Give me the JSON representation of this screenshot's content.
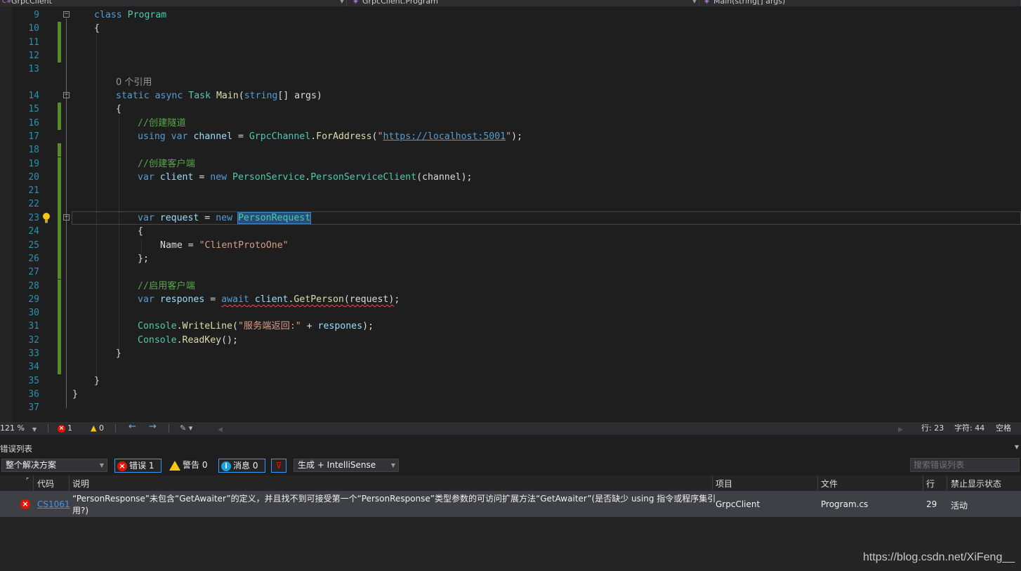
{
  "nav": {
    "project": "GrpcClient",
    "class": "GrpcClient.Program",
    "member": "Main(string[] args)"
  },
  "editor": {
    "codelens": "0 个引用",
    "lines": [
      {
        "n": "9"
      },
      {
        "n": "10"
      },
      {
        "n": "11"
      },
      {
        "n": "12"
      },
      {
        "n": "13"
      },
      {
        "n": "14"
      },
      {
        "n": "15"
      },
      {
        "n": "16"
      },
      {
        "n": "17"
      },
      {
        "n": "18"
      },
      {
        "n": "19"
      },
      {
        "n": "20"
      },
      {
        "n": "21"
      },
      {
        "n": "22"
      },
      {
        "n": "23"
      },
      {
        "n": "24"
      },
      {
        "n": "25"
      },
      {
        "n": "26"
      },
      {
        "n": "27"
      },
      {
        "n": "28"
      },
      {
        "n": "29"
      },
      {
        "n": "30"
      },
      {
        "n": "31"
      },
      {
        "n": "32"
      },
      {
        "n": "33"
      },
      {
        "n": "34"
      },
      {
        "n": "35"
      },
      {
        "n": "36"
      },
      {
        "n": "37"
      }
    ],
    "tokens": {
      "class_kw": "class",
      "program": "Program",
      "open_brace": "{",
      "close_brace": "}",
      "static": "static",
      "async": "async",
      "task": "Task",
      "main": "Main",
      "string": "string",
      "args_sig": "[] args)",
      "main_open": "(",
      "c1": "//创建隧道",
      "using": "using",
      "var": "var",
      "channel": "channel",
      "eq": " = ",
      "grpcchannel": "GrpcChannel",
      "foraddress": "ForAddress",
      "url_q1": "\"",
      "url": "https://localhost:5001",
      "url_tail": "\");",
      "c2": "//创建客户端",
      "client": "client",
      "new": "new",
      "personservice": "PersonService",
      "personserviceclient": "PersonServiceClient",
      "channel_arg": "(channel);",
      "request": "request",
      "personrequest": "PersonRequest",
      "name_prop": "Name",
      "name_val": "\"ClientProtoOne\"",
      "end_init": "};",
      "c3": "//启用客户端",
      "respones": "respones",
      "await": "await",
      "getperson": "GetPerson",
      "req_arg": "(request)",
      "semi": ";",
      "console": "Console",
      "writeline": "WriteLine",
      "write_str": "\"服务端返回:\"",
      "plus": " + ",
      "wl_tail": ");",
      "readkey": "ReadKey",
      "rk_tail": "();",
      "dot": ".",
      "lp": "(",
      "rp": ")",
      "comma": ","
    }
  },
  "status": {
    "zoom": "121 %",
    "errors": "1",
    "warnings": "0",
    "line": "行: 23",
    "char": "字符: 44",
    "mode": "空格"
  },
  "error_list": {
    "title": "错误列表",
    "scope": "整个解决方案",
    "errors_btn": "错误 1",
    "warnings_btn": "警告 0",
    "messages_btn": "消息 0",
    "build_filter": "生成 + IntelliSense",
    "search_placeholder": "搜索错误列表",
    "columns": {
      "code": "代码",
      "desc": "说明",
      "project": "项目",
      "file": "文件",
      "line": "行",
      "suppress": "禁止显示状态"
    },
    "rows": [
      {
        "code": "CS1061",
        "desc_1": "“PersonResponse”未包含“GetAwaiter”的定义，并且找不到可接受第一个“PersonResponse”类型参数的可访问扩展方法“GetAwaiter”(是否缺少 using 指令或程序集引",
        "desc_2": "用?)",
        "project": "GrpcClient",
        "file": "Program.cs",
        "line": "29",
        "suppress": "活动"
      }
    ]
  },
  "watermark": "https://blog.csdn.net/XiFeng__"
}
